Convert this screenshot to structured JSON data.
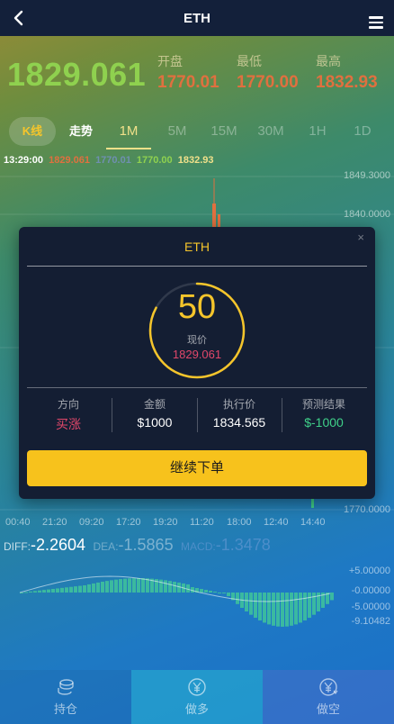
{
  "header": {
    "title": "ETH"
  },
  "price": {
    "current": "1829.061",
    "stats": [
      {
        "label": "开盘",
        "value": "1770.01"
      },
      {
        "label": "最低",
        "value": "1770.00"
      },
      {
        "label": "最高",
        "value": "1832.93"
      }
    ]
  },
  "tabs": {
    "kline": "K线",
    "trend": "走势",
    "periods": [
      "1M",
      "5M",
      "15M",
      "30M",
      "1H",
      "1D"
    ],
    "active_period": "1M"
  },
  "ohlc": {
    "time": "13:29:00",
    "v1": "1829.061",
    "v2": "1770.01",
    "v3": "1770.00",
    "v4": "1832.93"
  },
  "chart_axis": {
    "price_labels": [
      "1849.3000",
      "1840.0000",
      "1770.0000"
    ],
    "time_labels": [
      "00:40",
      "21:20",
      "09:20",
      "17:20",
      "19:20",
      "11:20",
      "18:00",
      "12:40",
      "14:40"
    ]
  },
  "macd": {
    "diff_label": "DIFF:",
    "diff_value": "-2.2604",
    "dea_label": "DEA:",
    "dea_value": "-1.5865",
    "macd_label": "MACD:",
    "macd_value": "-1.3478",
    "axis_labels": [
      "+5.00000",
      "-0.00000",
      "-5.00000",
      "-9.10482"
    ]
  },
  "bottom_bar": {
    "hold": "持仓",
    "long": "做多",
    "short": "做空"
  },
  "modal": {
    "title": "ETH",
    "close": "×",
    "countdown": "50",
    "countdown_progress": 0.83,
    "current_label": "现价",
    "current_value": "1829.061",
    "direction_label": "方向",
    "direction_value": "买涨",
    "amount_label": "金额",
    "amount_value": "$1000",
    "exec_label": "执行价",
    "exec_value": "1834.565",
    "forecast_label": "预测结果",
    "forecast_value": "$-1000",
    "continue_label": "继续下单"
  },
  "colors": {
    "accent": "#f5c52b",
    "up": "#e0476a",
    "down": "#3fd089",
    "price": "#8fd14f"
  }
}
